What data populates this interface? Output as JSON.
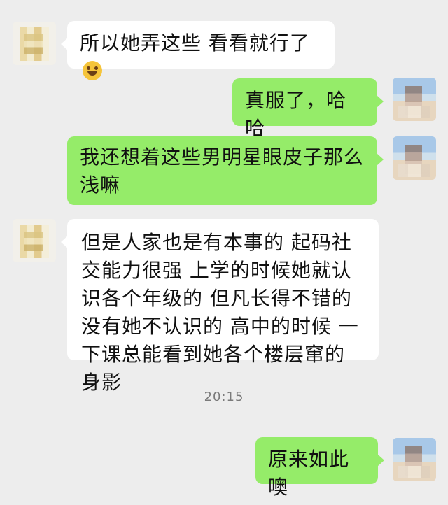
{
  "messages": [
    {
      "side": "left",
      "text": "所以她弄这些 看看就行了",
      "emoji": "rolling-on-floor-laughing"
    },
    {
      "side": "right",
      "text": "真服了，哈哈"
    },
    {
      "side": "right",
      "text": "我还想着这些男明星眼皮子那么浅嘛"
    },
    {
      "side": "left",
      "text": "但是人家也是有本事的 起码社交能力很强 上学的时候她就认识各个年级的 但凡长得不错的 没有她不认识的 高中的时候 一下课总能看到她各个楼层窜的身影"
    },
    {
      "side": "right",
      "text": "原来如此噢"
    }
  ],
  "timestamp": "20:15",
  "colors": {
    "background": "#ededed",
    "incoming_bubble": "#ffffff",
    "outgoing_bubble": "#95ec69",
    "timestamp_text": "#7a7a7a"
  }
}
